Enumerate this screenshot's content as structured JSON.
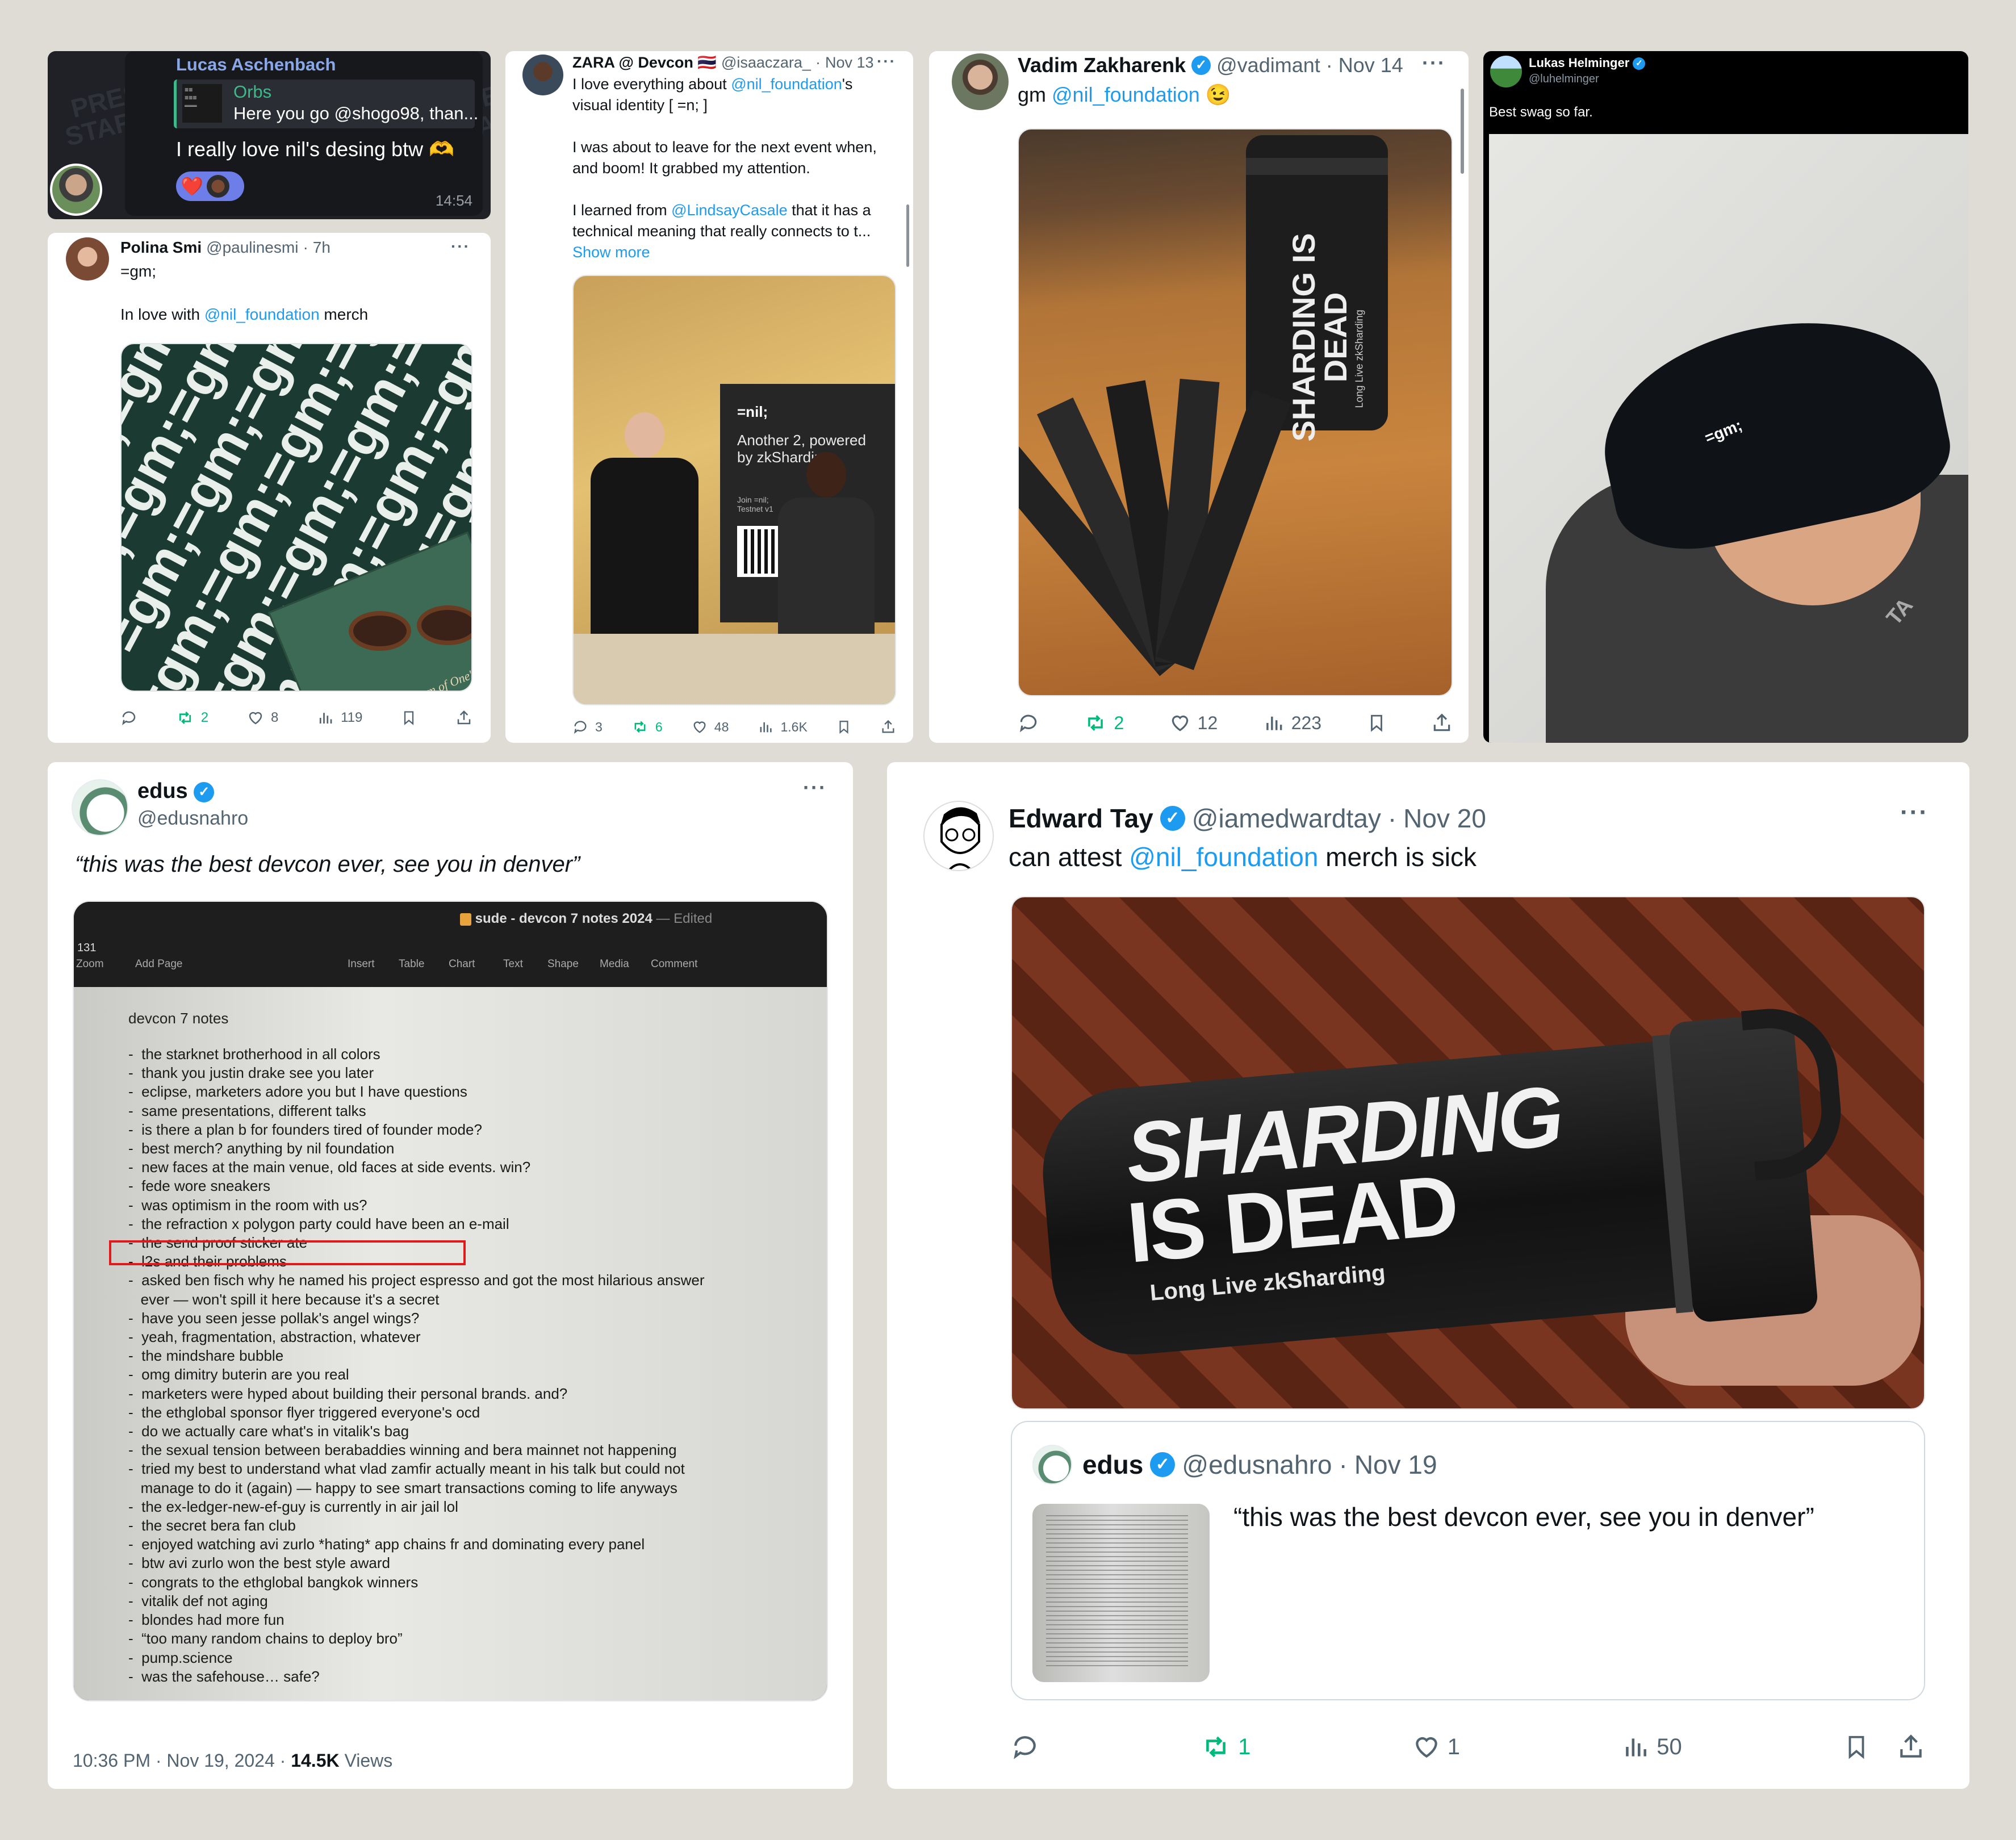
{
  "telegram": {
    "sender": "Lucas Aschenbach",
    "reply_name": "Orbs",
    "reply_text": "Here you go @shogo98, than...",
    "message": "I really love nil's desing btw 🫶",
    "time": "14:54",
    "reactions": [
      "❤️"
    ],
    "bg_words": [
      "PRES",
      "STAR",
      "PRE",
      "STA"
    ]
  },
  "polina": {
    "name": "Polina Smi",
    "handle": "@paulinesmi",
    "time": "7h",
    "line1": "=gm;",
    "text_before": "In love with ",
    "mention": "@nil_foundation",
    "text_after": " merch",
    "pattern": "=gm;",
    "book_text": "A Room of One's Own",
    "stats": {
      "retweets": "2",
      "likes": "8",
      "views": "119"
    }
  },
  "zara": {
    "name": "ZARA @ Devcon 🇹🇭",
    "handle": "@isaaczara_",
    "time": "Nov 13",
    "p1_before": "I love everything about ",
    "p1_mention": "@nil_foundation",
    "p1_after": "'s",
    "p1_line2": "visual identity [ =n; ]",
    "p2_l1": "I was about to leave for the next event when,",
    "p2_l2": "and boom! It grabbed my attention.",
    "p3_before": "I learned from ",
    "p3_mention": "@LindsayCasale",
    "p3_after": " that it has a",
    "p3_l2": "technical meaning that really connects to t...",
    "show_more": "Show more",
    "banner_logo": "=nil;",
    "banner_text": "Another 2, powered by zkSharding",
    "banner_join": "Join =nil; Testnet v1",
    "stats": {
      "replies": "3",
      "retweets": "6",
      "likes": "48",
      "views": "1.6K"
    }
  },
  "vadim": {
    "name": "Vadim Zakharenk",
    "handle": "@vadimant",
    "time": "Nov 14",
    "text_before": "gm ",
    "mention": "@nil_foundation",
    "emoji": "😉",
    "bottle_text": "SHARDING IS DEAD",
    "bottle_sub": "Long Live zkSharding",
    "stats": {
      "retweets": "2",
      "likes": "12",
      "views": "223"
    }
  },
  "lukas": {
    "name": "Lukas Helminger",
    "handle": "@luhelminger",
    "text": "Best swag so far.",
    "cap_logo": "=gm;",
    "shirt_mark": "TA"
  },
  "edus": {
    "name": "edus",
    "handle": "@edusnahro",
    "quote": "“this was the best devcon ever, see you in denver”",
    "doc_title": "sude - devcon 7 notes 2024",
    "doc_status": "Edited",
    "zoom": "131",
    "toolbar": [
      "Zoom",
      "Add Page",
      "Insert",
      "Table",
      "Chart",
      "Text",
      "Shape",
      "Media",
      "Comment"
    ],
    "notes_heading": "devcon 7 notes",
    "notes": [
      "the starknet brotherhood in all colors",
      "thank you justin drake see you later",
      "eclipse, marketers adore you but I have questions",
      "same presentations, different talks",
      "is there a plan b for founders tired of founder mode?",
      "best merch? anything by nil foundation",
      "new faces at the main venue, old faces at side events. win?",
      "fede wore sneakers",
      "was optimism in the room with us?",
      "the refraction x polygon party could have been an e-mail",
      "the send proof sticker ate",
      "l2s and their problems",
      "asked ben fisch why he named his project espresso and got the most hilarious answer",
      "ever — won't spill it here because it's a secret",
      "have you seen jesse pollak's angel wings?",
      "yeah, fragmentation, abstraction, whatever",
      "the mindshare bubble",
      "omg dimitry buterin are you real",
      "marketers were hyped about building their personal brands. and?",
      "the ethglobal sponsor flyer triggered everyone's ocd",
      "do we actually care what's in vitalik's bag",
      "the sexual tension between berabaddies winning and bera mainnet not happening",
      "tried my best to understand what vlad zamfir actually meant in his talk but could not",
      "manage to do it (again) — happy to see smart transactions coming to life anyways",
      "the ex-ledger-new-ef-guy is currently in air jail lol",
      "the secret bera fan club",
      "enjoyed watching avi zurlo *hating* app chains fr and dominating every panel",
      "btw avi zurlo won the best style award",
      "congrats to the ethglobal bangkok winners",
      "vitalik def not aging",
      "blondes had more fun",
      "“too many random chains to deploy bro”",
      "pump.science",
      "was the safehouse… safe?"
    ],
    "footer_time": "10:36 PM · Nov 19, 2024 · ",
    "footer_views": "14.5K",
    "footer_views_label": " Views"
  },
  "edward": {
    "name": "Edward Tay",
    "handle": "@iamedwardtay",
    "time": "Nov 20",
    "text_before": "can attest ",
    "mention": "@nil_foundation",
    "text_after": " merch is sick",
    "bottle_l1": "SHARDING",
    "bottle_l2": "IS DEAD",
    "bottle_sub": "Long Live zkSharding",
    "quoted": {
      "name": "edus",
      "handle": "@edusnahro",
      "time": "Nov 19",
      "text": "“this was the best devcon ever, see you in denver”"
    },
    "stats": {
      "retweets": "1",
      "likes": "1",
      "views": "50"
    }
  },
  "colors": {
    "accent": "#1d9bf0",
    "retweet": "#00ba7c",
    "background": "#dfdbd5",
    "highlight_box": "#e0191c"
  }
}
